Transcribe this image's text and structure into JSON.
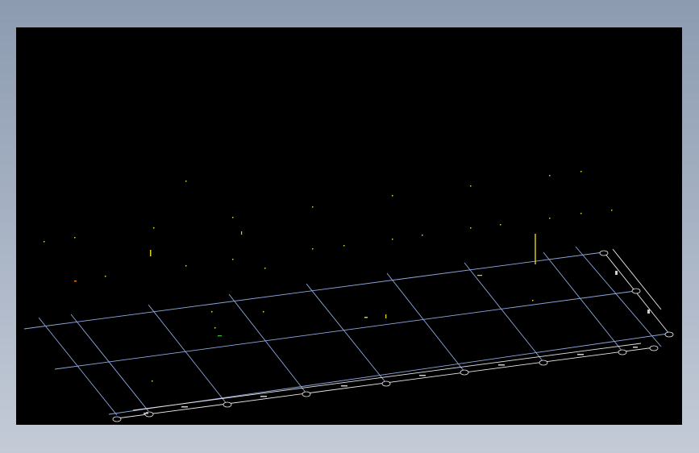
{
  "app": {
    "background_top": "#8c9bb0",
    "background_bottom": "#c4cbd7",
    "viewport_color": "#000000",
    "grid_color": "#8ea8e0",
    "dimension_color": "#e8e8e8",
    "object_color": "#e0d21a"
  },
  "drawing": {
    "view": "isometric",
    "grid_axes_count_a": 8,
    "grid_axes_count_b": 3
  }
}
